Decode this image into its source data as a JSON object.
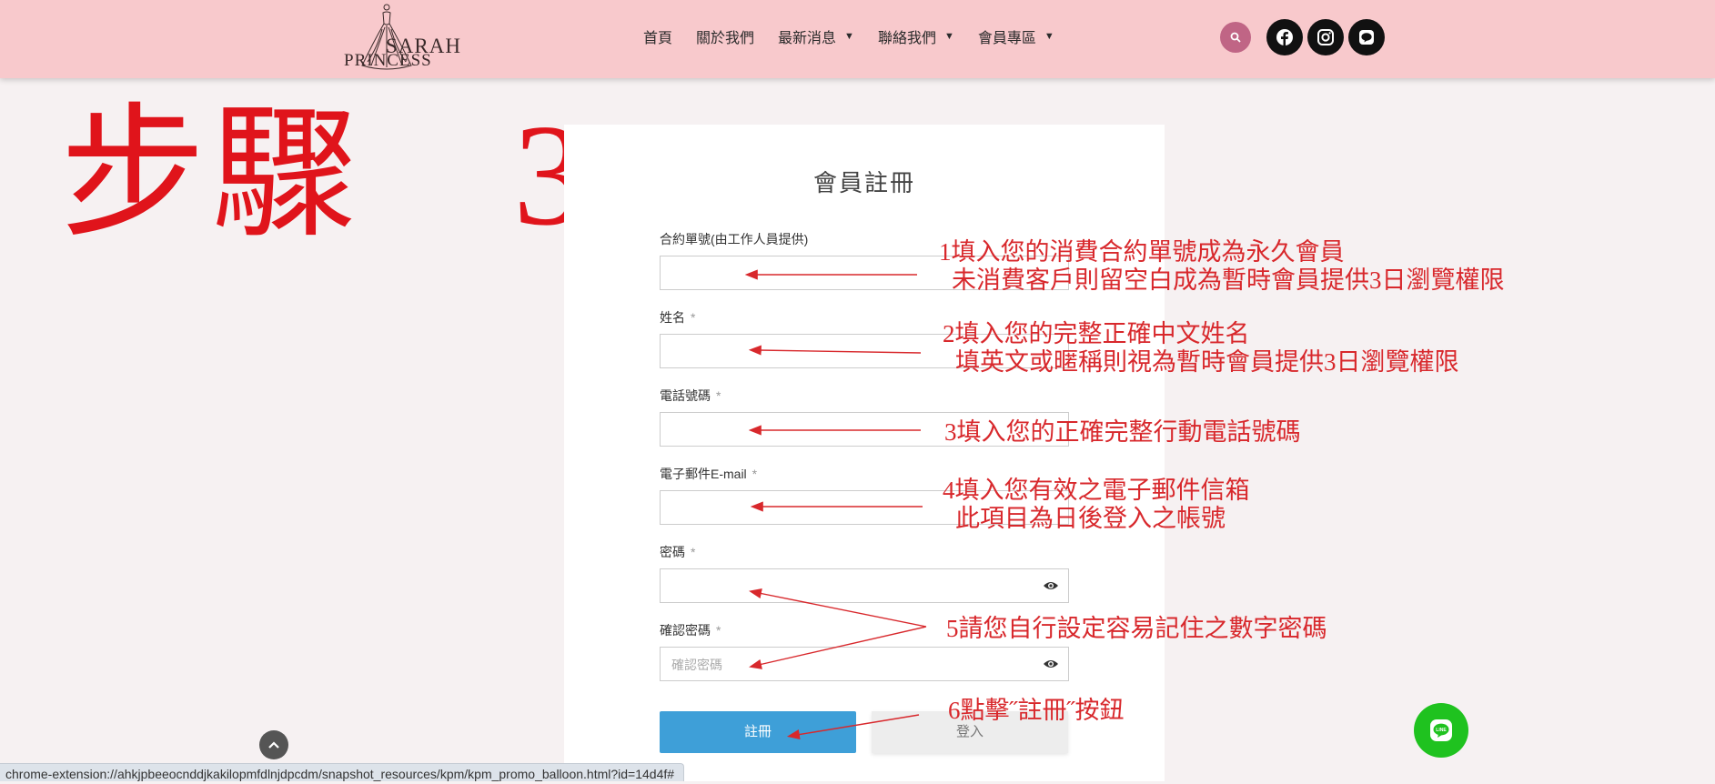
{
  "header": {
    "logo_line1": "SARAH",
    "logo_line2": "PRINCESS",
    "nav": [
      {
        "label": "首頁",
        "has_dropdown": false
      },
      {
        "label": "關於我們",
        "has_dropdown": false
      },
      {
        "label": "最新消息",
        "has_dropdown": true
      },
      {
        "label": "聯絡我們",
        "has_dropdown": true
      },
      {
        "label": "會員專區",
        "has_dropdown": true
      }
    ],
    "icons": {
      "search": "search-icon",
      "facebook": "facebook-icon",
      "instagram": "instagram-icon",
      "line": "line-icon"
    }
  },
  "step_label": "步驟　3",
  "form": {
    "title": "會員註冊",
    "fields": [
      {
        "label": "合約單號(由工作人員提供)",
        "required": false,
        "value": "",
        "placeholder": ""
      },
      {
        "label": "姓名",
        "required": true,
        "value": "",
        "placeholder": ""
      },
      {
        "label": "電話號碼",
        "required": true,
        "value": "",
        "placeholder": ""
      },
      {
        "label": "電子郵件E-mail",
        "required": true,
        "value": "",
        "placeholder": ""
      },
      {
        "label": "密碼",
        "required": true,
        "value": "",
        "placeholder": ""
      },
      {
        "label": "確認密碼",
        "required": true,
        "value": "",
        "placeholder": "確認密碼"
      }
    ],
    "required_mark": "*",
    "register_label": "註冊",
    "login_label": "登入"
  },
  "annotations": {
    "a1_line1": "1填入您的消費合約單號成為永久會員",
    "a1_line2": "未消費客戶則留空白成為暫時會員提供3日瀏覽權限",
    "a2_line1": "2填入您的完整正確中文姓名",
    "a2_line2": "填英文或暱稱則視為暫時會員提供3日瀏覽權限",
    "a3": "3填入您的正確完整行動電話號碼",
    "a4_line1": "4填入您有效之電子郵件信箱",
    "a4_line2": "此項目為日後登入之帳號",
    "a5": "5請您自行設定容易記住之數字密碼",
    "a6": "6點擊˝註冊˝按鈕"
  },
  "status_url": "chrome-extension://ahkjpbeeocnddjkakilopmfdlnjdpcdm/snapshot_resources/kpm/kpm_promo_balloon.html?id=14d4f#",
  "colors": {
    "header_bg": "#f8c9cc",
    "annotation_red": "#d8282c",
    "register_blue": "#3e9fd8",
    "line_green": "#1fc21f"
  }
}
